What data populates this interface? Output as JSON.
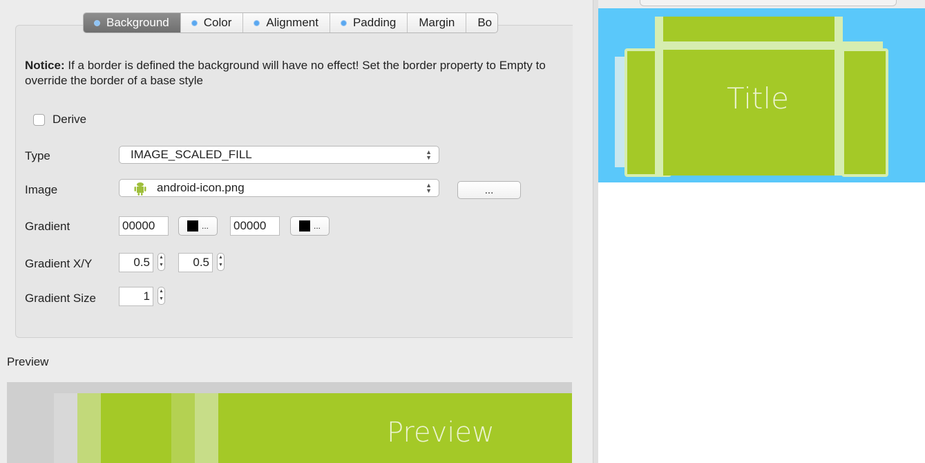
{
  "tabs": [
    {
      "label": "Background",
      "selected": true,
      "dot": true
    },
    {
      "label": "Color",
      "selected": false,
      "dot": true
    },
    {
      "label": "Alignment",
      "selected": false,
      "dot": true
    },
    {
      "label": "Padding",
      "selected": false,
      "dot": true
    },
    {
      "label": "Margin",
      "selected": false,
      "dot": false
    },
    {
      "label": "Bo",
      "selected": false,
      "dot": false
    }
  ],
  "notice": {
    "bold": "Notice:",
    "text": " If a border is defined the background will have no effect! Set the border property to Empty to override the border of a base style"
  },
  "derive": {
    "label": "Derive",
    "checked": false
  },
  "type": {
    "label": "Type",
    "value": "IMAGE_SCALED_FILL"
  },
  "image": {
    "label": "Image",
    "value": "android-icon.png",
    "icon": "android-icon",
    "browse_label": "..."
  },
  "gradient": {
    "label": "Gradient",
    "color1": "00000",
    "color2": "00000",
    "picker_label": "...",
    "swatch_color": "#000000"
  },
  "gradient_xy": {
    "label": "Gradient X/Y",
    "x": "0.5",
    "y": "0.5"
  },
  "gradient_size": {
    "label": "Gradient Size",
    "value": "1"
  },
  "preview": {
    "label": "Preview",
    "text": "Preview"
  },
  "canvas": {
    "title": "Title",
    "bg_color": "#5ac8fa",
    "fill_color": "#a4c927"
  }
}
